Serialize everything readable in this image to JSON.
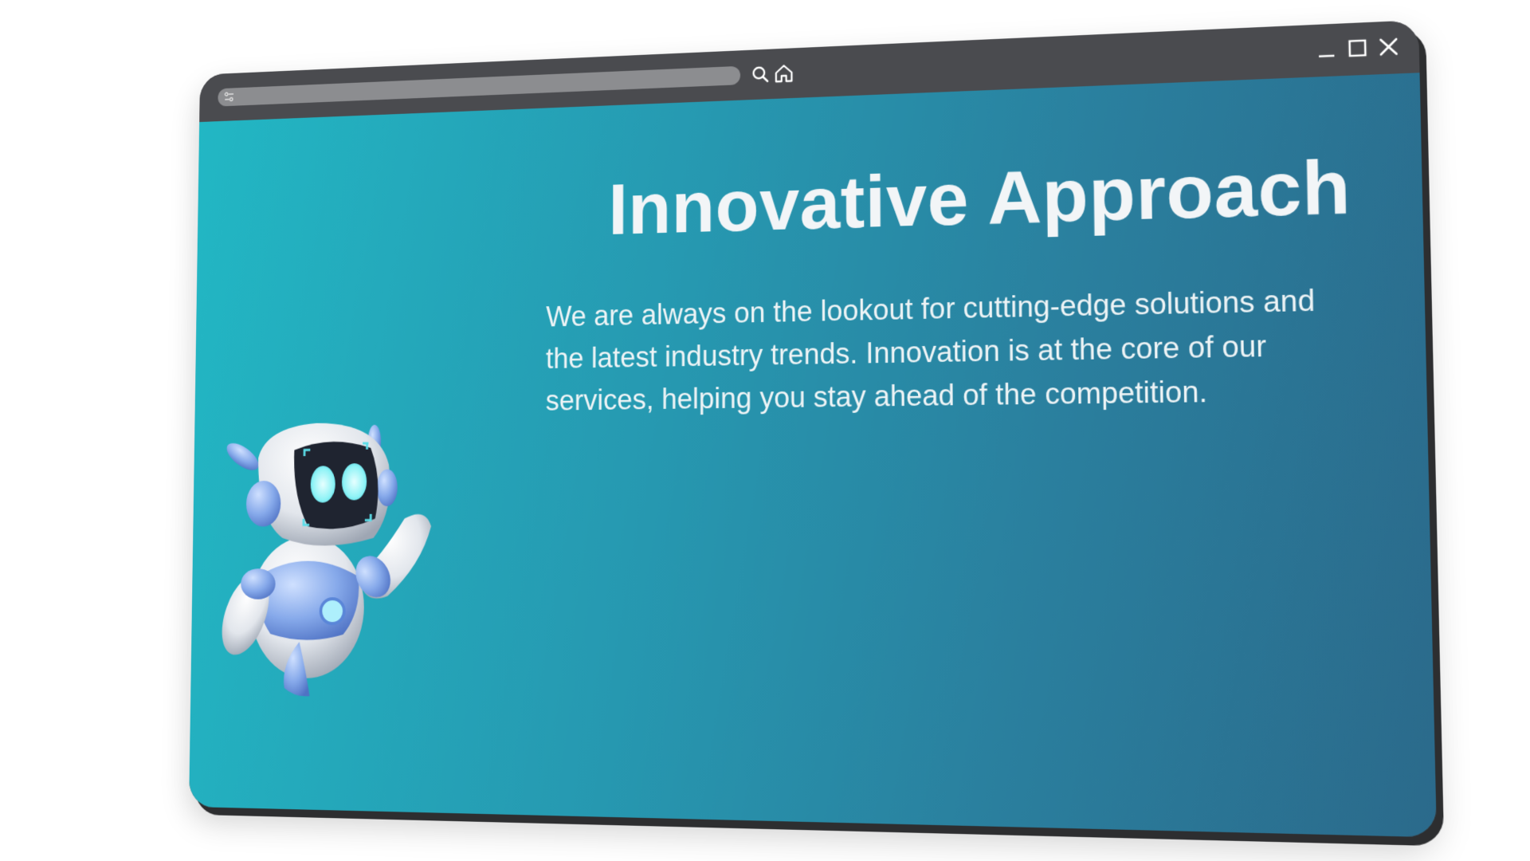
{
  "window": {
    "address_bar_value": "",
    "controls": {
      "minimize": "minimize",
      "maximize": "maximize",
      "close": "close"
    }
  },
  "hero": {
    "title": "Innovative Approach",
    "description": "We are always on the lookout for cutting-edge solutions and the latest industry trends. Innovation is at the core of our services, helping you stay ahead of the competition."
  },
  "icons": {
    "address_settings": "sliders-icon",
    "search": "search-icon",
    "home": "home-icon",
    "minimize": "minimize-icon",
    "maximize": "maximize-icon",
    "close": "close-icon",
    "mascot": "robot-mascot"
  },
  "colors": {
    "frame": "#4a4b4f",
    "address_bar": "#8c8d90",
    "gradient_start": "#22b7c4",
    "gradient_end": "#2b6a8b",
    "text": "#f2f5f7"
  }
}
